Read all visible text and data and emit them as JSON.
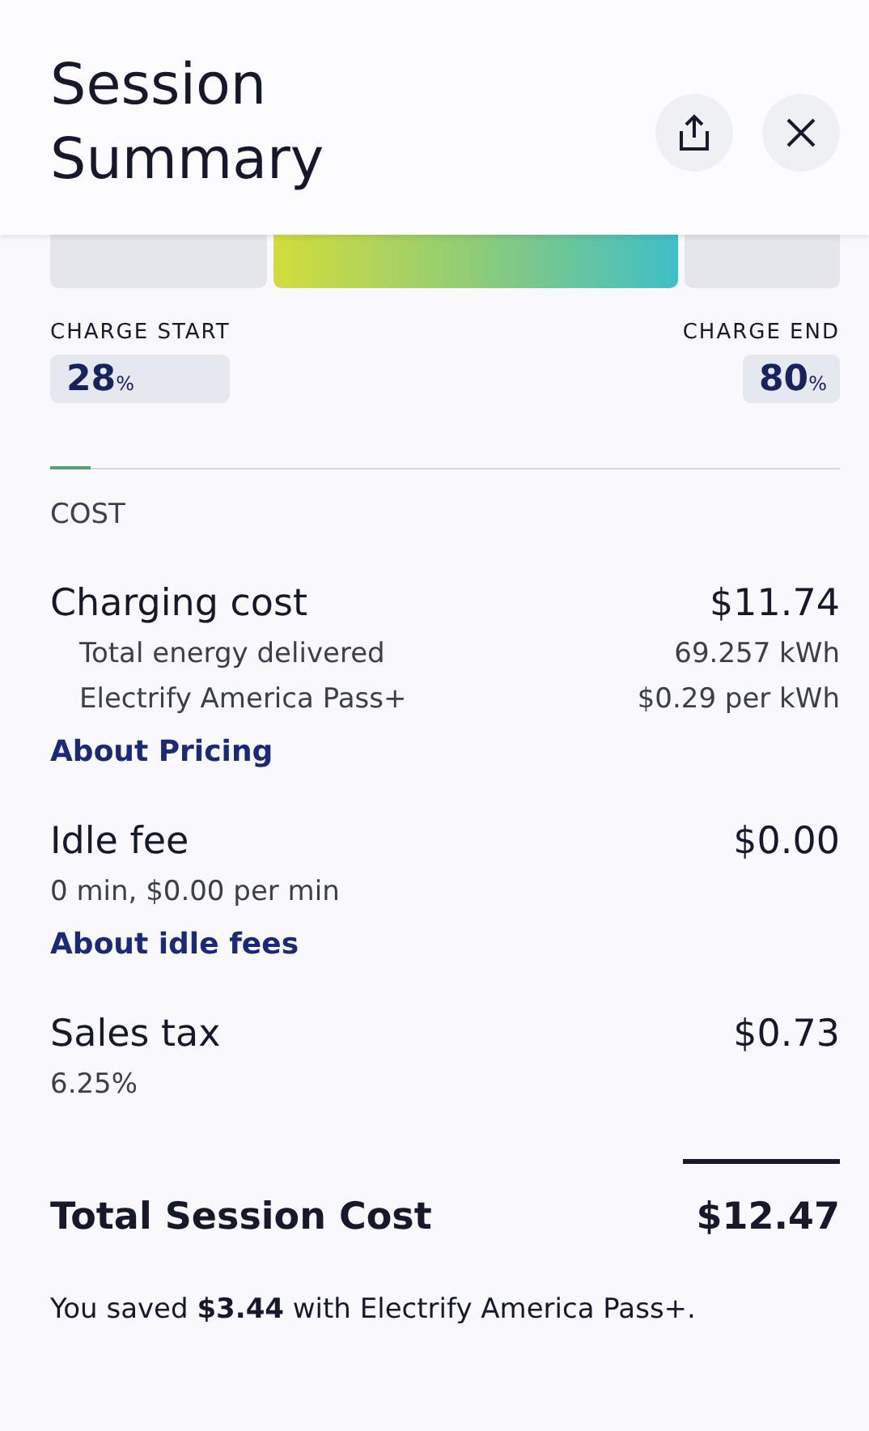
{
  "header": {
    "title": "Session Summary"
  },
  "charge": {
    "start_label": "CHARGE START",
    "start_value": "28",
    "start_unit": "%",
    "end_label": "CHARGE END",
    "end_value": "80",
    "end_unit": "%"
  },
  "section": {
    "title": "COST"
  },
  "cost_groups": [
    {
      "label": "Charging cost",
      "amount": "$11.74",
      "details": [
        {
          "label": "Total energy delivered",
          "value": "69.257 kWh"
        },
        {
          "label": "Electrify America Pass+",
          "value": "$0.29 per kWh"
        }
      ],
      "link": "About Pricing"
    },
    {
      "label": "Idle fee",
      "amount": "$0.00",
      "note": "0 min, $0.00 per min",
      "link": "About idle fees"
    },
    {
      "label": "Sales tax",
      "amount": "$0.73",
      "note": "6.25%"
    }
  ],
  "total": {
    "label": "Total Session Cost",
    "amount": "$12.47"
  },
  "savings": "You saved **$3.44** with Electrify America Pass+."
}
